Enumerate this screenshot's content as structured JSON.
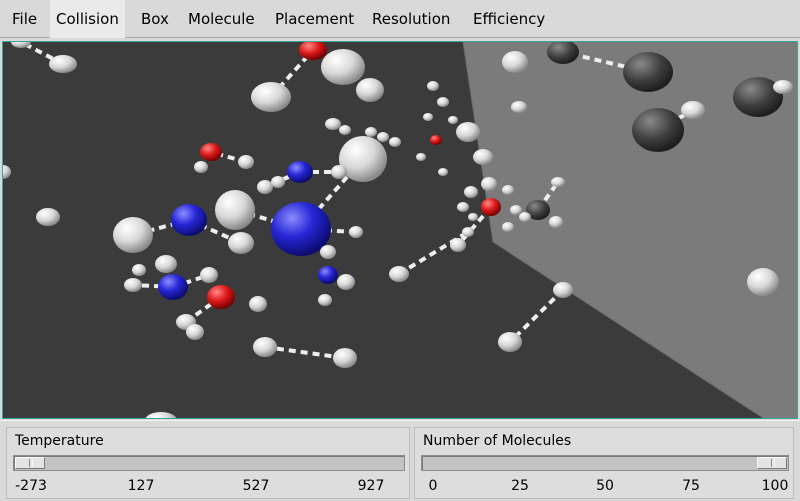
{
  "menu": {
    "items": [
      "File",
      "Collision",
      "Box",
      "Molecule",
      "Placement",
      "Resolution",
      "Efficiency"
    ],
    "active_index": 1
  },
  "temperature": {
    "label": "Temperature",
    "ticks": [
      "-273",
      "127",
      "527",
      "927"
    ],
    "min": -273,
    "max": 1000,
    "value": -273
  },
  "molecules": {
    "label": "Number of Molecules",
    "ticks": [
      "0",
      "25",
      "50",
      "75",
      "100"
    ],
    "min": 0,
    "max": 100,
    "value": 100
  },
  "colors": {
    "hydrogen": "#e8e8e8",
    "oxygen": "#e02020",
    "nitrogen": "#2a2ad8",
    "background": "#3b3b3b",
    "wall": "#7b7b7b",
    "frame": "#3aa59a"
  }
}
